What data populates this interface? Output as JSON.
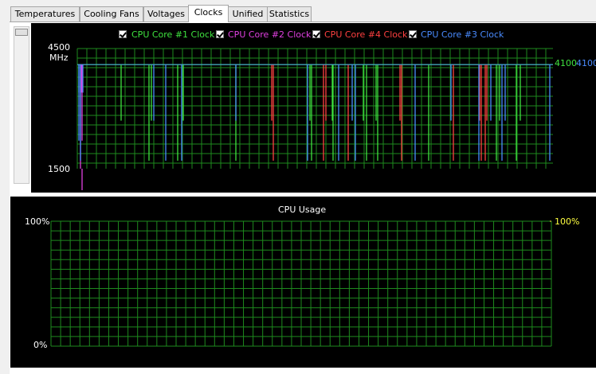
{
  "tabs": [
    {
      "label": "Temperatures",
      "active": false
    },
    {
      "label": "Cooling Fans",
      "active": false
    },
    {
      "label": "Voltages",
      "active": false
    },
    {
      "label": "Clocks",
      "active": true
    },
    {
      "label": "Unified",
      "active": false
    },
    {
      "label": "Statistics",
      "active": false
    }
  ],
  "clock_chart": {
    "legend": [
      {
        "label": "CPU Core #1 Clock",
        "color": "#3fe23f",
        "checked": true
      },
      {
        "label": "CPU Core #2 Clock",
        "color": "#e040e0",
        "checked": true
      },
      {
        "label": "CPU Core #4 Clock",
        "color": "#ff4040",
        "checked": true
      },
      {
        "label": "CPU Core #3 Clock",
        "color": "#4a8cff",
        "checked": true
      }
    ],
    "y_max": "4500",
    "y_unit": "MHz",
    "y_min": "1500",
    "right_value_1": "4100",
    "right_value_2": "4100",
    "right_value_1_color": "#3fe23f",
    "right_value_2_color": "#4a8cff"
  },
  "usage_chart": {
    "title": "CPU Usage",
    "y_max": "100%",
    "y_min": "0%",
    "right_value": "100%",
    "right_value_color": "#ffff40",
    "color": "#ffff40"
  },
  "chart_data": [
    {
      "type": "line",
      "ylim": [
        1500,
        4500
      ],
      "ylabel": "MHz",
      "series": [
        {
          "name": "CPU Core #1 Clock",
          "color": "#3fe23f",
          "baseline": 4100,
          "dips": [
            [
              152,
              2700
            ],
            [
              187,
              1700
            ],
            [
              190,
              2700
            ],
            [
              223,
              1700
            ],
            [
              230,
              2700
            ],
            [
              296,
              1700
            ],
            [
              389,
              2700
            ],
            [
              391,
              1700
            ],
            [
              417,
              2700
            ],
            [
              418,
              1700
            ],
            [
              456,
              2700
            ],
            [
              460,
              1700
            ],
            [
              472,
              2700
            ],
            [
              474,
              1700
            ],
            [
              538,
              1700
            ],
            [
              623,
              1700
            ],
            [
              627,
              2700
            ],
            [
              648,
              1700
            ],
            [
              653,
              2700
            ]
          ]
        },
        {
          "name": "CPU Core #2 Clock",
          "color": "#e040e0",
          "baseline": 4100,
          "dips": [
            [
              101,
              1500
            ],
            [
              102,
              3400
            ],
            [
              103,
              2200
            ]
          ]
        },
        {
          "name": "CPU Core #4 Clock",
          "color": "#ff4040",
          "baseline": 4100,
          "dips": [
            [
              341,
              2700
            ],
            [
              343,
              1700
            ],
            [
              406,
              1700
            ],
            [
              409,
              2700
            ],
            [
              437,
              1700
            ],
            [
              502,
              2700
            ],
            [
              504,
              1700
            ],
            [
              569,
              1700
            ],
            [
              602,
              2700
            ],
            [
              604,
              1700
            ],
            [
              609,
              1700
            ],
            [
              611,
              2700
            ]
          ]
        },
        {
          "name": "CPU Core #3 Clock",
          "color": "#4a8cff",
          "baseline": 4100,
          "dips": [
            [
              99,
              3400
            ],
            [
              104,
              3400
            ],
            [
              99,
              2200
            ],
            [
              101,
              1700
            ],
            [
              193,
              2700
            ],
            [
              208,
              1700
            ],
            [
              228,
              1700
            ],
            [
              296,
              2700
            ],
            [
              386,
              1700
            ],
            [
              425,
              1700
            ],
            [
              442,
              2700
            ],
            [
              446,
              1700
            ],
            [
              521,
              1700
            ],
            [
              566,
              2700
            ],
            [
              601,
              1700
            ],
            [
              616,
              2700
            ],
            [
              630,
              1700
            ],
            [
              634,
              2700
            ],
            [
              690,
              1700
            ]
          ]
        }
      ]
    },
    {
      "type": "line",
      "title": "CPU Usage",
      "ylim": [
        0,
        100
      ],
      "series": [
        {
          "name": "CPU Usage",
          "color": "#ffff40",
          "values": [
            100
          ]
        }
      ]
    }
  ]
}
